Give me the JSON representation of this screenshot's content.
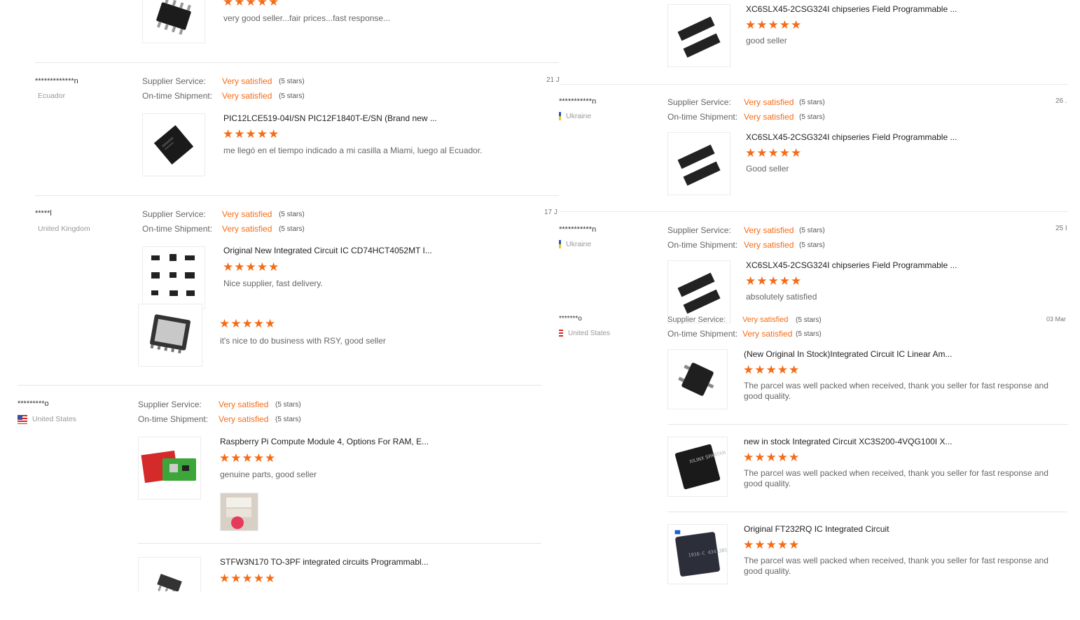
{
  "labels": {
    "supplier_service": "Supplier Service:",
    "ontime_shipment": "On-time Shipment:",
    "very_satisfied": "Very satisfied",
    "five_stars": "(5 stars)",
    "stars": "★★★★★"
  },
  "left_reviews": [
    {
      "comment": "very good seller...fair prices...fast response..."
    },
    {
      "name": "*************n",
      "country": "Ecuador",
      "date": "21 J",
      "product": "PIC12LCE519-04I/SN PIC12F1840T-E/SN (Brand new ...",
      "comment": "me llegó en el tiempo indicado a mi casilla a Miami, luego al Ecuador."
    },
    {
      "name": "*****l",
      "country": "United Kingdom",
      "date": "17 J",
      "product": "Original New Integrated Circuit IC CD74HCT4052MT I...",
      "comment": "Nice supplier, fast delivery.",
      "extra_comment": "it's nice to do business with RSY, good seller"
    },
    {
      "name": "*********o",
      "country": "United States",
      "product": "Raspberry Pi Compute Module 4, Options For RAM, E...",
      "comment": "genuine parts, good seller",
      "product2": "STFW3N170 TO-3PF integrated circuits Programmabl..."
    }
  ],
  "right_reviews": [
    {
      "product": "XC6SLX45-2CSG324I chipseries Field Programmable ...",
      "comment": "good seller"
    },
    {
      "name": "***********n",
      "country": "Ukraine",
      "date": "26 .",
      "product": "XC6SLX45-2CSG324I chipseries Field Programmable ...",
      "comment": "Good seller"
    },
    {
      "name": "***********n",
      "country": "Ukraine",
      "date": "25 I",
      "product": "XC6SLX45-2CSG324I chipseries Field Programmable ...",
      "comment": "absolutely satisfied"
    },
    {
      "name": "*******o",
      "country": "United States",
      "date": "03 Mar",
      "items": [
        {
          "product": "(New Original In Stock)Integrated Circuit IC Linear Am...",
          "comment": "The parcel was well packed when received,  thank you seller for fast response and good quality."
        },
        {
          "product": "new in stock Integrated Circuit XC3S200-4VQG100I X...",
          "comment": "The parcel was well packed when received,  thank you seller for fast response and good quality."
        },
        {
          "product": "Original FT232RQ IC Integrated Circuit",
          "comment": "The parcel was well packed when received,  thank you seller for fast response and good quality."
        }
      ]
    }
  ],
  "thumb_texts": {
    "chip_marking": "1916-C 4341301 FT232RQ",
    "xilinx_marking": "XILINX SPARTAN"
  }
}
